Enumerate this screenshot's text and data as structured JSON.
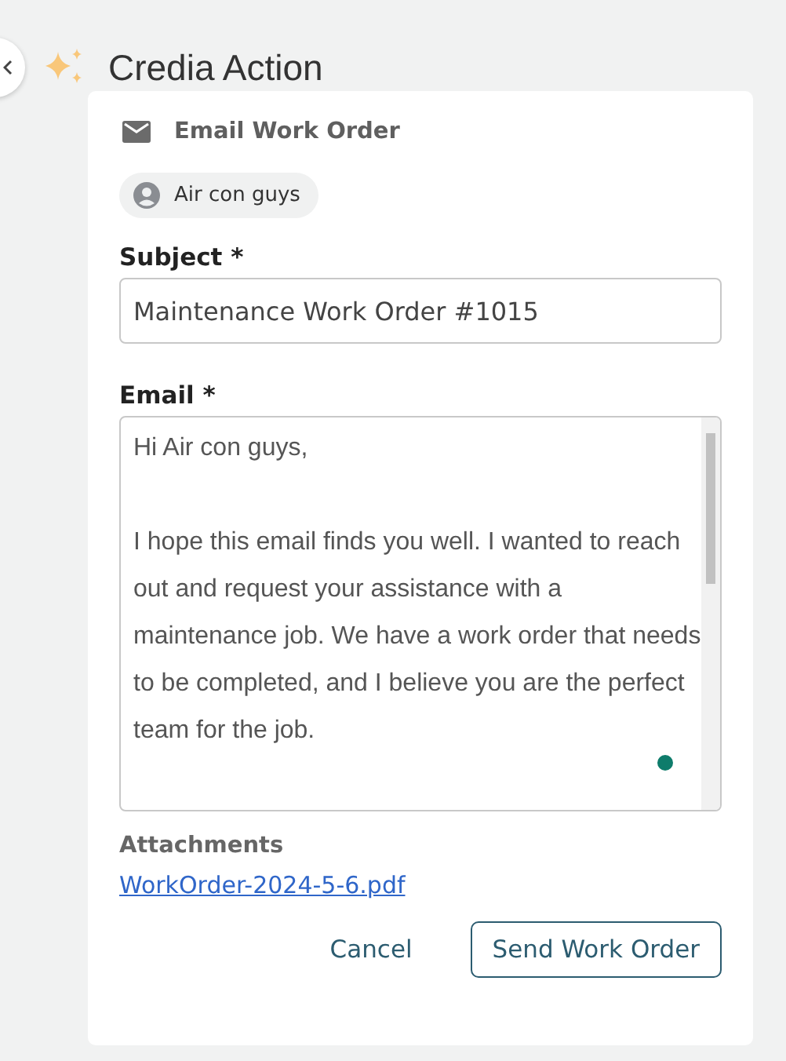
{
  "header": {
    "title": "Credia Action"
  },
  "card": {
    "title": "Email Work Order",
    "recipient": "Air con guys",
    "subject": {
      "label": "Subject *",
      "value": "Maintenance Work Order #1015"
    },
    "email": {
      "label": "Email *",
      "value": "Hi Air con guys,\n\nI hope this email finds you well. I wanted to reach out and request your assistance with a maintenance job. We have a work order that needs to be completed, and I believe you are the perfect team for the job."
    },
    "attachments": {
      "label": "Attachments",
      "files": [
        "WorkOrder-2024-5-6.pdf"
      ]
    },
    "buttons": [
      {
        "label": "Cancel",
        "kind": "text"
      },
      {
        "label": "Send Work Order",
        "kind": "outlined"
      }
    ]
  }
}
